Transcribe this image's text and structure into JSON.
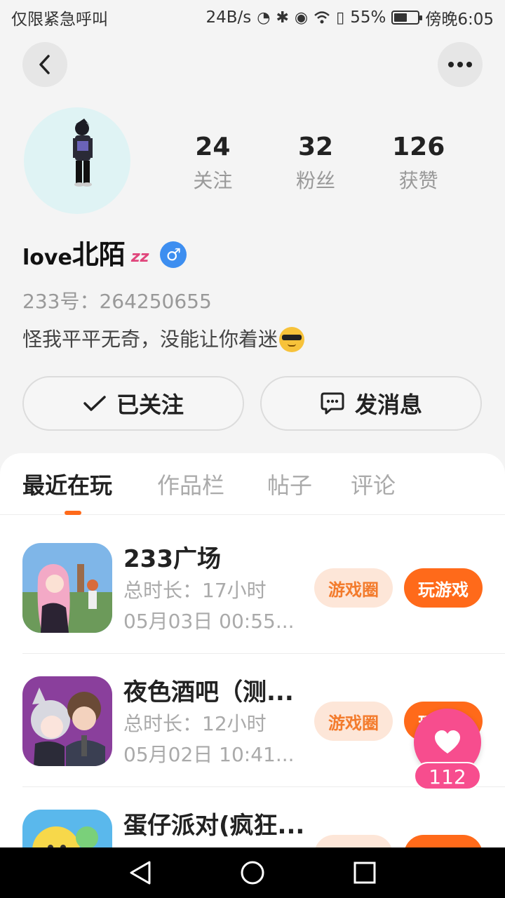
{
  "status_bar": {
    "carrier": "仅限紧急呼叫",
    "speed": "24B/s",
    "battery": "55%",
    "battery_level": 0.55,
    "time": "傍晚6:05"
  },
  "profile": {
    "stats": [
      {
        "value": "24",
        "label": "关注"
      },
      {
        "value": "32",
        "label": "粉丝"
      },
      {
        "value": "126",
        "label": "获赞"
      }
    ],
    "name_prefix": "love",
    "name_main": "北陌",
    "name_suffix": "zz",
    "gender_symbol": "♂",
    "uid": "233号：264250655",
    "bio": "怪我平平无奇，没能让你着迷"
  },
  "actions": {
    "follow_label": "已关注",
    "message_label": "发消息"
  },
  "tabs": [
    {
      "label": "最近在玩",
      "active": true
    },
    {
      "label": "作品栏",
      "active": false
    },
    {
      "label": "帖子",
      "active": false
    },
    {
      "label": "评论",
      "active": false
    }
  ],
  "games": [
    {
      "title": "233广场",
      "duration": "总时长：17小时",
      "date": "05月03日 00:55...",
      "circle_label": "游戏圈",
      "play_label": "玩游戏"
    },
    {
      "title": "夜色酒吧（测...",
      "duration": "总时长：12小时",
      "date": "05月02日 10:41...",
      "circle_label": "游戏圈",
      "play_label": "玩游戏"
    },
    {
      "title": "蛋仔派对(疯狂...",
      "duration": "",
      "date": "",
      "circle_label": "",
      "play_label": ""
    }
  ],
  "float_like": {
    "count": "112"
  },
  "colors": {
    "accent": "#ff6a1a",
    "like": "#f74d8e",
    "gender": "#3d8ef0"
  }
}
